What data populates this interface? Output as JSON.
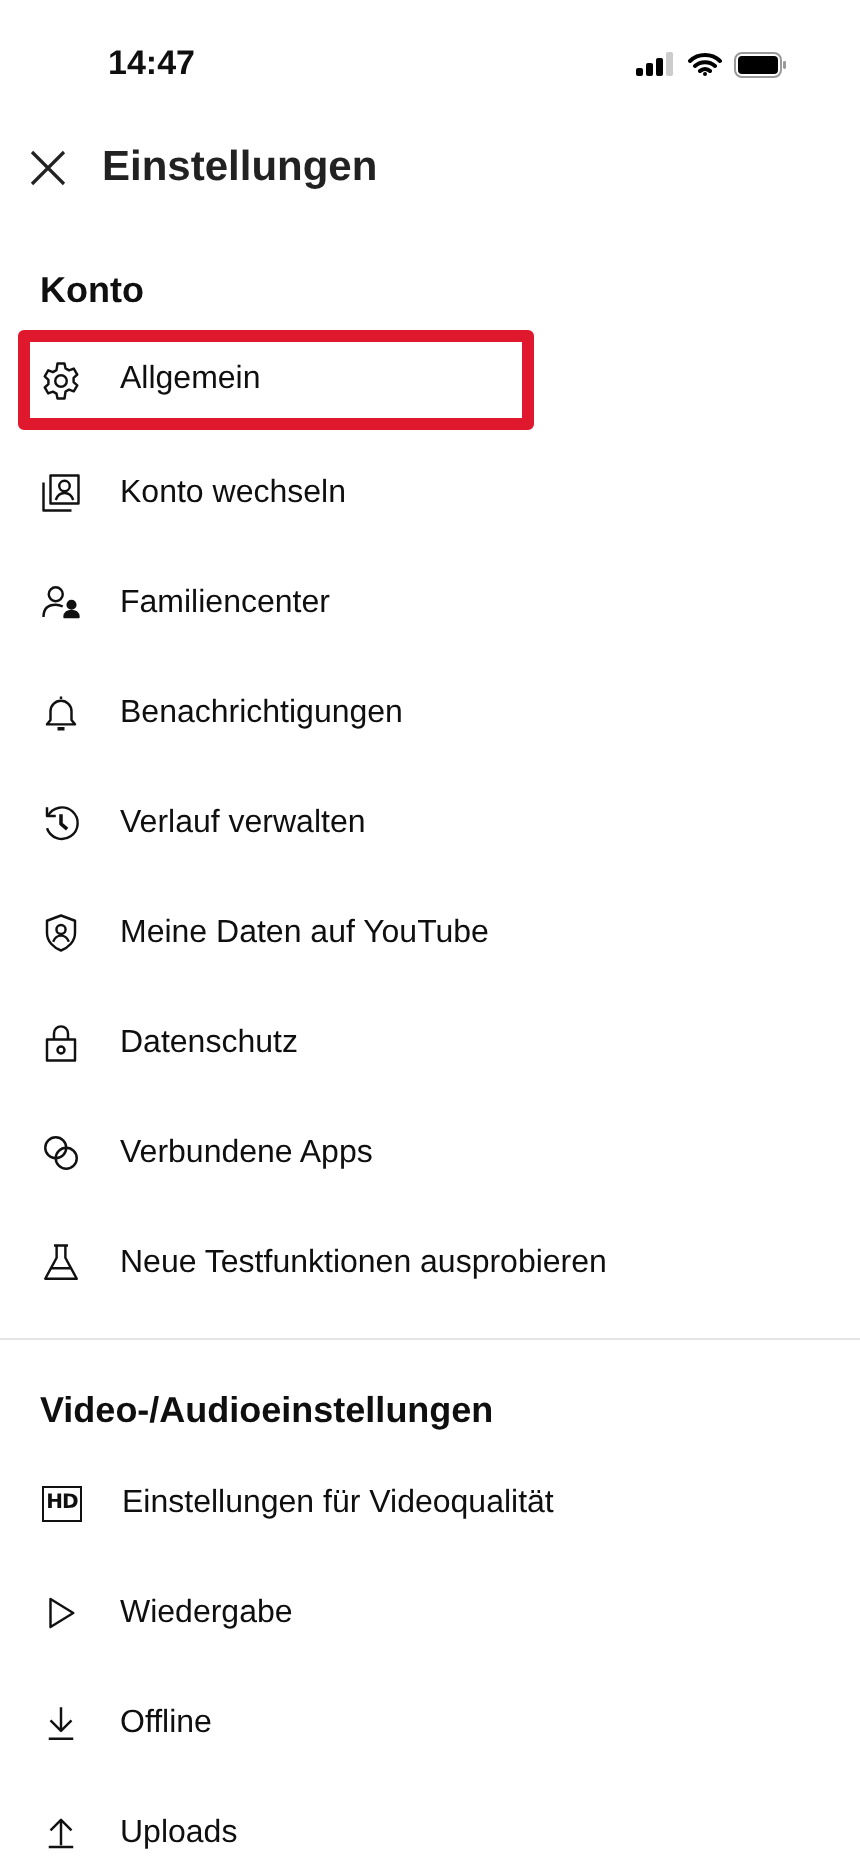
{
  "status_bar": {
    "time": "14:47"
  },
  "header": {
    "title": "Einstellungen"
  },
  "sections": [
    {
      "title": "Konto",
      "items": [
        {
          "kind": "gear",
          "label": "Allgemein",
          "highlighted": true
        },
        {
          "kind": "switch-account",
          "label": "Konto wechseln",
          "highlighted": false
        },
        {
          "kind": "family",
          "label": "Familiencenter",
          "highlighted": false
        },
        {
          "kind": "bell",
          "label": "Benachrichtigungen",
          "highlighted": false
        },
        {
          "kind": "history",
          "label": "Verlauf verwalten",
          "highlighted": false
        },
        {
          "kind": "shield",
          "label": "Meine Daten auf YouTube",
          "highlighted": false
        },
        {
          "kind": "lock",
          "label": "Datenschutz",
          "highlighted": false
        },
        {
          "kind": "rings",
          "label": "Verbundene Apps",
          "highlighted": false
        },
        {
          "kind": "flask",
          "label": "Neue Testfunktionen ausprobieren",
          "highlighted": false
        }
      ]
    },
    {
      "title": "Video-/Audioeinstellungen",
      "items": [
        {
          "kind": "hd",
          "icon_text": "HD",
          "label": "Einstellungen für Videoqualität",
          "highlighted": false
        },
        {
          "kind": "play",
          "label": "Wiedergabe",
          "highlighted": false
        },
        {
          "kind": "download",
          "label": "Offline",
          "highlighted": false
        },
        {
          "kind": "upload",
          "label": "Uploads",
          "highlighted": false
        }
      ]
    }
  ]
}
